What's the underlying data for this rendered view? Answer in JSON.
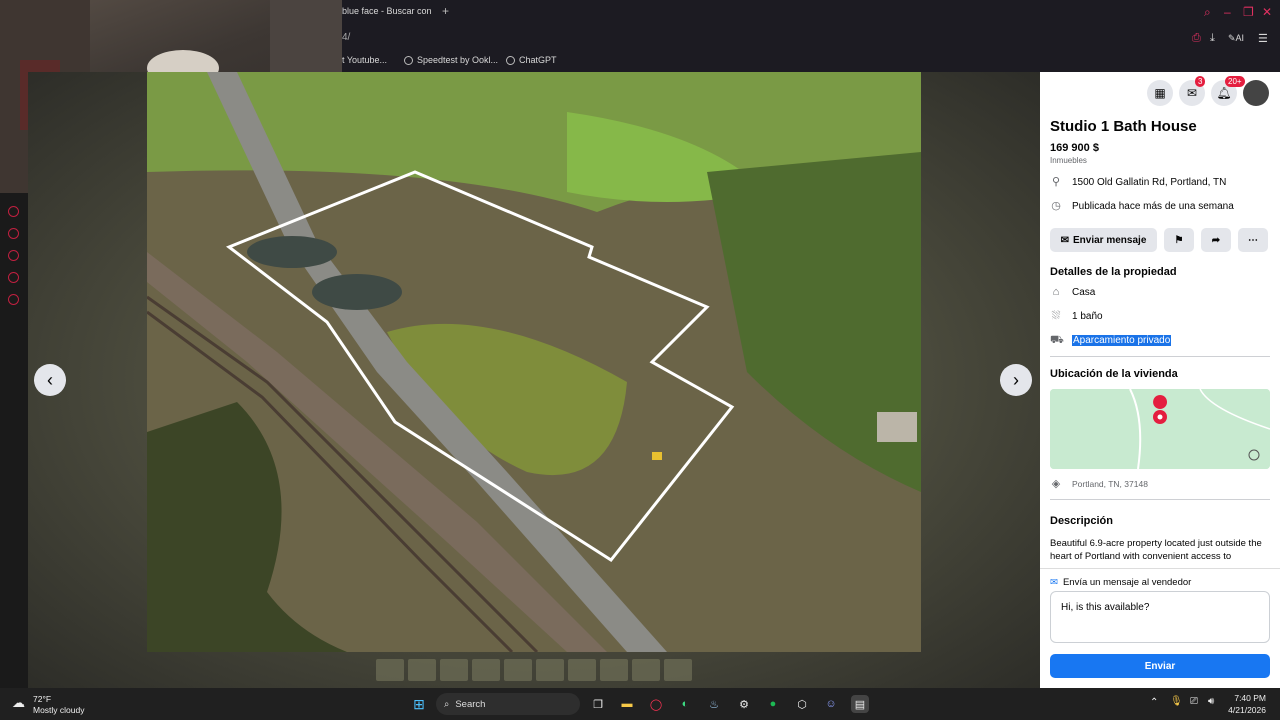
{
  "browser": {
    "tab_title": "blue face - Buscar con",
    "tab_new": "+",
    "url_fragment": "4/",
    "bookmarks": [
      {
        "label": "t Youtube...",
        "icon": "youtube-icon"
      },
      {
        "label": "Speedtest by Ookl...",
        "icon": "speedtest-icon"
      },
      {
        "label": "ChatGPT",
        "icon": "chatgpt-icon"
      }
    ],
    "ai_label": "AI"
  },
  "viewer": {
    "prev_label": "‹",
    "next_label": "›",
    "thumbnail_count": 10
  },
  "panel": {
    "messenger_badge": "3",
    "notifications_badge": "20+",
    "title": "Studio 1 Bath House",
    "price": "169 900 $",
    "category": "Inmuebles",
    "address": "1500 Old Gallatin Rd, Portland, TN",
    "posted": "Publicada hace más de una semana",
    "send_message_label": "Enviar mensaje",
    "details_heading": "Detalles de la propiedad",
    "details": [
      {
        "label": "Casa",
        "icon": "house-icon"
      },
      {
        "label": "1 baño",
        "icon": "bath-icon"
      },
      {
        "label": "Aparcamiento privado",
        "icon": "car-icon"
      }
    ],
    "location_heading": "Ubicación de la vivienda",
    "map_location": "Portland, TN, 37148",
    "description_heading": "Descripción",
    "description_text": "Beautiful 6.9-acre property located just outside the heart of Portland with convenient access to",
    "message_heading": "Envía un mensaje al vendedor",
    "message_input": "Hi, is this available?",
    "send_label": "Enviar"
  },
  "taskbar": {
    "weather_temp": "72°F",
    "weather_desc": "Mostly cloudy",
    "search_label": "Search",
    "time": "7:40 PM",
    "date": "4/21/2026"
  }
}
